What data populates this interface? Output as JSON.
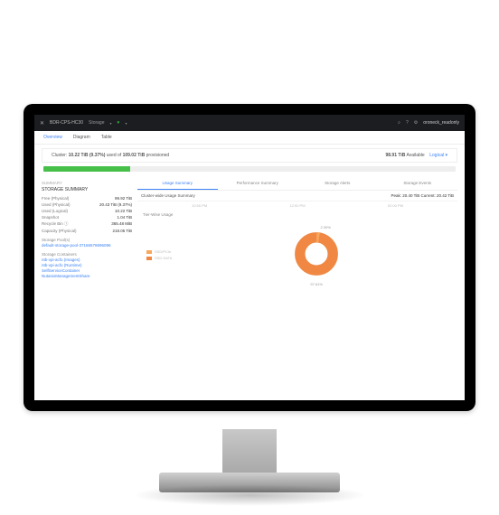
{
  "topbar": {
    "title": "BDR-CPS-HC30",
    "section": "Storage",
    "heart": "♥",
    "user": "oroneck_readonly",
    "q": "?"
  },
  "nav": {
    "overview": "Overview",
    "diagram": "Diagram",
    "table": "Table"
  },
  "cluster": {
    "label_prefix": "Cluster:",
    "used": "10.22 TiB (9.37%)",
    "used_word": "used of",
    "total": "109.02 TiB",
    "prov": "provisioned",
    "available": "98.91 TiB",
    "avail_word": "Available",
    "logical": "Logical"
  },
  "sidebar": {
    "summary": "Summary",
    "storage_summary": "STORAGE SUMMARY",
    "rows": [
      {
        "lbl": "Free (Physical)",
        "val": "99.92 TiB"
      },
      {
        "lbl": "Used (Physical)",
        "val": "20.43 TiB (9.37%)"
      },
      {
        "lbl": "Used (Logical)",
        "val": "10.22 TiB"
      },
      {
        "lbl": "Snapshot",
        "val": "1.04 TiB"
      },
      {
        "lbl": "Recycle Bin ⓘ",
        "val": "365.48 MiB"
      },
      {
        "lbl": "Capacity (Physical)",
        "val": "218.05 TiB"
      }
    ],
    "pools_hdr": "Storage Pool(s)",
    "pool_link": "default-storage-pool-37166578696096",
    "containers_hdr": "Storage Containers",
    "container_links": [
      "ntb-vpi-acfo (Images)",
      "ntb-vpi-acfo (Runtime)",
      "SelfServiceContainer",
      "NutanixManagementShare"
    ]
  },
  "tabs": {
    "usage": "Usage Summary",
    "perf": "Performance Summary",
    "alerts": "Storage Alerts",
    "events": "Storage Events"
  },
  "subheader": {
    "left": "Cluster-wide Usage Summary",
    "right": "Peak: 20.40 TiB  Current: 20.42 TiB"
  },
  "times": {
    "a": "10:55 PM",
    "b": "12:00 PM",
    "c": "02:00 PM"
  },
  "tier": {
    "title": "Tier-Wise Usage"
  },
  "legend": {
    "a": "SSD/PCIe",
    "b": "SSD-SATA"
  },
  "chart_data": {
    "type": "pie",
    "title": "Tier-Wise Usage",
    "slices": [
      {
        "name": "SSD/PCIe",
        "value": 2.39,
        "color": "#f7a85e"
      },
      {
        "name": "SSD-SATA",
        "value": 97.61,
        "color": "#f08844"
      }
    ],
    "labels": {
      "top": "2.39%",
      "bottom": "97.61%"
    }
  }
}
